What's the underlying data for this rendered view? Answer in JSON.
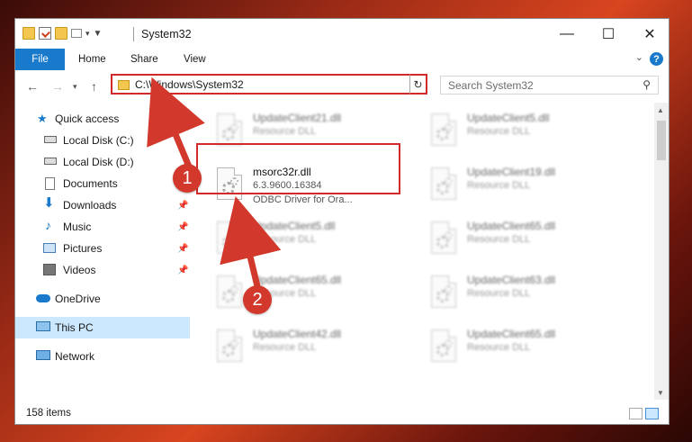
{
  "window": {
    "title": "System32"
  },
  "ribbon": {
    "file": "File",
    "home": "Home",
    "share": "Share",
    "view": "View",
    "help": "?"
  },
  "address": {
    "path": "C:\\Windows\\System32",
    "search_placeholder": "Search System32"
  },
  "nav": {
    "items": [
      {
        "label": "Quick access"
      },
      {
        "label": "Local Disk (C:)"
      },
      {
        "label": "Local Disk (D:)"
      },
      {
        "label": "Documents"
      },
      {
        "label": "Downloads"
      },
      {
        "label": "Music"
      },
      {
        "label": "Pictures"
      },
      {
        "label": "Videos"
      },
      {
        "label": "OneDrive"
      },
      {
        "label": "This PC"
      },
      {
        "label": "Network"
      }
    ]
  },
  "files": {
    "left": [
      {
        "name": "UpdateClient21.dll",
        "type": "Resource DLL"
      },
      {
        "name": "msorc32r.dll",
        "version": "6.3.9600.16384",
        "desc": "ODBC Driver for Ora..."
      },
      {
        "name": "UpdateClient5.dll",
        "type": "Resource DLL"
      },
      {
        "name": "UpdateClient65.dll",
        "type": "Resource DLL"
      },
      {
        "name": "UpdateClient42.dll",
        "type": "Resource DLL"
      }
    ],
    "right": [
      {
        "name": "UpdateClient5.dll",
        "type": "Resource DLL"
      },
      {
        "name": "UpdateClient19.dll",
        "type": "Resource DLL"
      },
      {
        "name": "UpdateClient65.dll",
        "type": "Resource DLL"
      },
      {
        "name": "UpdateClient63.dll",
        "type": "Resource DLL"
      },
      {
        "name": "UpdateClient65.dll",
        "type": "Resource DLL"
      }
    ]
  },
  "status": {
    "count": "158 items"
  },
  "annotations": {
    "step1": "1",
    "step2": "2",
    "color": "#d2392c"
  }
}
